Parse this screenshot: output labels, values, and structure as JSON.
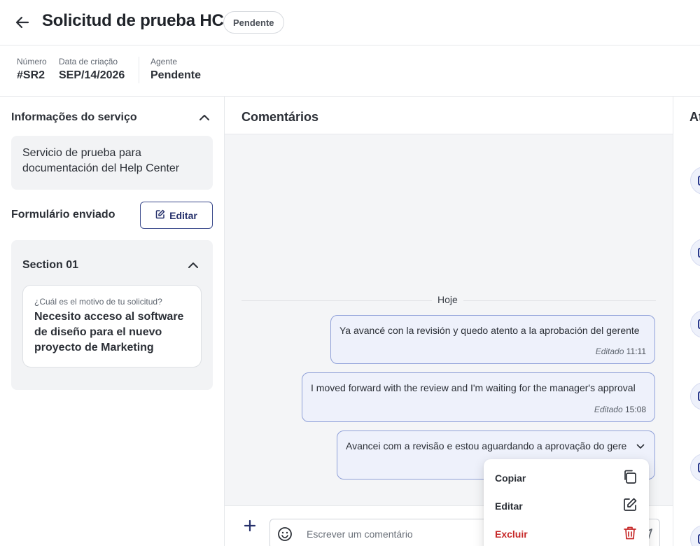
{
  "header": {
    "title": "Solicitud de prueba HC",
    "status": "Pendente"
  },
  "meta": {
    "number_label": "Número",
    "number_value": "#SR2",
    "created_label": "Data de criação",
    "created_value": "SEP/14/2026",
    "agent_label": "Agente",
    "agent_value": "Pendente"
  },
  "service_info": {
    "title": "Informações do serviço",
    "description": "Servicio de prueba para documentación del Help Center",
    "form_label": "Formulário enviado",
    "edit_label": "Editar",
    "section": {
      "title": "Section 01",
      "question": "¿Cuál es el motivo de tu solicitud?",
      "answer": "Necesito acceso al software de diseño para el nuevo proyecto de Marketing"
    }
  },
  "comments": {
    "title": "Comentários",
    "day_label": "Hoje",
    "messages": [
      {
        "text": "Ya avancé con la revisión y quedo atento a la aprobación del gerente",
        "edited": "Editado",
        "time": "11:11"
      },
      {
        "text": "I moved forward with the review and I'm waiting for the manager's approval",
        "edited": "Editado",
        "time": "15:08"
      },
      {
        "text": "Avancei com a revisão e estou aguardando a aprovação do gere"
      }
    ],
    "input_placeholder": "Escrever um comentário"
  },
  "context_menu": {
    "items": [
      {
        "label": "Copiar",
        "icon": "copy-icon"
      },
      {
        "label": "Editar",
        "icon": "edit-icon"
      },
      {
        "label": "Excluir",
        "icon": "trash-icon",
        "danger_color": "#c62828"
      }
    ]
  },
  "activity": {
    "title": "At"
  },
  "colors": {
    "accent": "#25306b",
    "bubble_bg": "#eef1fb",
    "bubble_border": "#8fa0d8",
    "danger": "#c62828"
  }
}
